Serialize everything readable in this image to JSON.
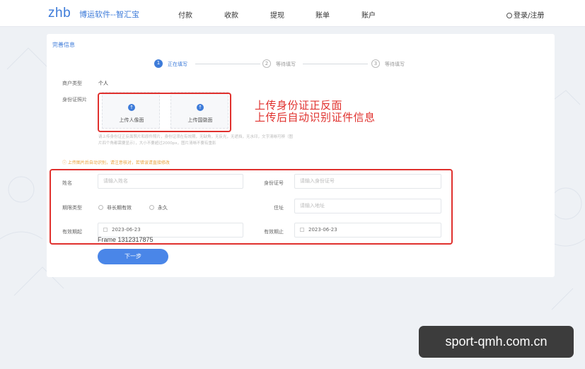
{
  "header": {
    "logo": "zhb",
    "brand": "博运软件--智汇宝",
    "nav": [
      "付款",
      "收款",
      "提现",
      "账单",
      "账户"
    ],
    "user": "登录/注册"
  },
  "card": {
    "title": "完善信息",
    "steps": [
      {
        "num": "1",
        "label": "正在填写",
        "active": true
      },
      {
        "num": "2",
        "label": "等待填写",
        "active": false
      },
      {
        "num": "3",
        "label": "等待填写",
        "active": false
      }
    ],
    "merchant_type": {
      "label": "商户类型",
      "value": "个人"
    },
    "id_photo": {
      "label": "身份证照片",
      "front": "上传人像面",
      "back": "上传国徽面"
    },
    "upload_note_1": "请上传身份证正反面照片和原件照片，身份证须在有效期，无缺角，无反光，无遮挡，无水印，文字清晰可辨（图",
    "upload_note_2": "片四个角都需要显示），大小不要超过2000px，图片清晰不要有重影",
    "warning": "上传图片后自动识别，请注意核对，若错误请直接修改",
    "form": {
      "name": {
        "label": "姓名",
        "placeholder": "请输入姓名"
      },
      "id_number": {
        "label": "身份证号",
        "placeholder": "请输入身份证号"
      },
      "period_type": {
        "label": "期限类型",
        "options": [
          "非长期有效",
          "永久"
        ]
      },
      "address": {
        "label": "住址",
        "placeholder": "请输入地址"
      },
      "valid_from": {
        "label": "有效期起",
        "value": "2023-06-23"
      },
      "valid_to": {
        "label": "有效期止",
        "value": "2023-06-23"
      }
    },
    "frame_label": "Frame 1312317875",
    "next_button": "下一步"
  },
  "annotation": {
    "line1": "上传身份证正反面",
    "line2": "上传后自动识别证件信息"
  },
  "watermark": "sport-qmh.com.cn",
  "colors": {
    "accent": "#3d7bd9",
    "highlight": "#e0312e",
    "warning": "#e8a23b"
  }
}
